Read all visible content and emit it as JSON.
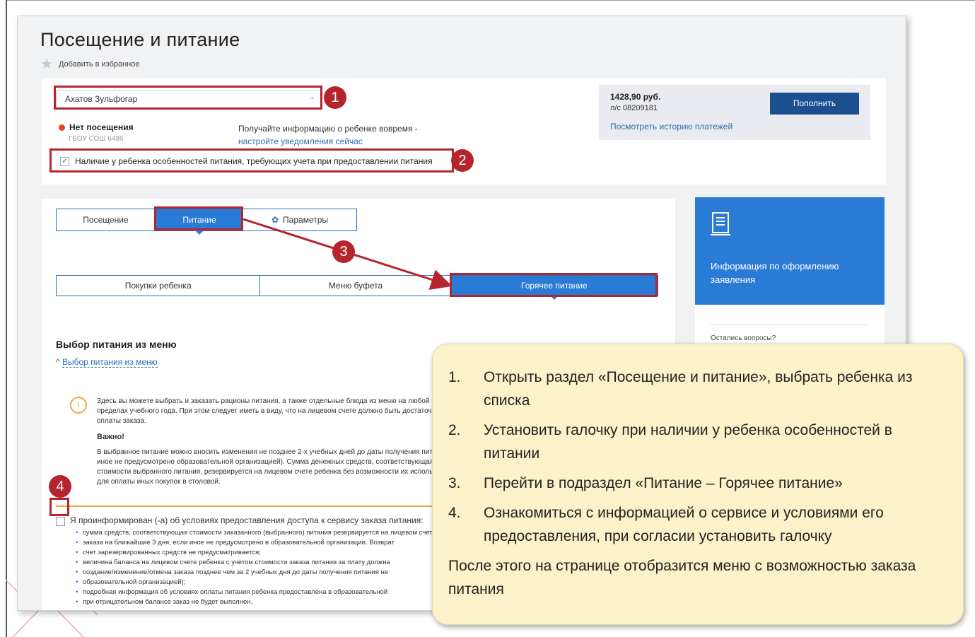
{
  "page": {
    "title": "Посещение и питание",
    "favorite": "Добавить в избранное"
  },
  "child": {
    "selected": "Ахатов Зульфогар",
    "status": "Нет посещения",
    "school": "ГБОУ СОШ 6486",
    "notify_text": "Получайте информацию о ребенке вовремя -",
    "notify_link": "настройте уведомления сейчас",
    "feature_label": "Наличие у ребенка особенностей питания, требующих учета при предоставлении питания"
  },
  "balance": {
    "amount": "1428,90 руб.",
    "account": "л/с 08209181",
    "history_link": "Посмотреть историю платежей",
    "topup_button": "Пополнить"
  },
  "tabs": [
    {
      "label": "Посещение",
      "active": false
    },
    {
      "label": "Питание",
      "active": true
    },
    {
      "label": "Параметры",
      "active": false
    }
  ],
  "subtabs": [
    {
      "label": "Покупки ребенка",
      "active": false
    },
    {
      "label": "Меню буфета",
      "active": false
    },
    {
      "label": "Горячее питание",
      "active": true
    }
  ],
  "section": {
    "title": "Выбор питания из меню",
    "toggle": "Выбор питания из меню",
    "info_text": "Здесь вы можете выбрать и заказать рационы питания, а также отдельные блюда из меню на любой период в пределах учебного года. При этом следует иметь в виду, что на лицевом счете должно быть достаточно для оплаты заказа.",
    "important": "Важно!",
    "info_text2": "В выбранное питание можно вносить изменения не позднее 2-х учебных дней до даты получения питания (если иное не предусмотрено образовательной организацией). Сумма денежных средств, соответствующая стоимости выбранного питания, резервируется на лицевом счете ребенка без возможности их использования для оплаты иных покупок в столовой."
  },
  "agreement": {
    "label": "Я проинформирован (-а) об условиях предоставления доступа к сервису заказа питания:",
    "items": [
      "сумма средств, соответствующая стоимости заказанного (выбранного) питания резервируется на лицевом счете ребенка",
      "заказа на ближайшие 3 дня, если иное не предусмотрено в образовательной организации. Возврат",
      "счет зарезервированных средств не предусматривается;",
      "величина баланса на лицевом счете ребенка с учетом стоимости заказа питания за плату должна",
      "создание/изменение/отмена заказа позднее чем за 2 учебных дня до даты получения питания не",
      "образовательной организацией);",
      "подробная информация об условиях оплаты питания ребенка предоставлена в образовательной",
      "при отрицательном балансе заказ не будет выполнен."
    ]
  },
  "sidebar": {
    "info_text": "Информация по оформлению заявления",
    "questions": "Остались вопросы?"
  },
  "badges": [
    "1",
    "2",
    "3",
    "4"
  ],
  "instructions": {
    "steps": [
      {
        "num": "1.",
        "text": "Открыть раздел «Посещение и питание», выбрать ребенка из списка"
      },
      {
        "num": "2.",
        "text": "Установить галочку при наличии у ребенка особенностей в питании"
      },
      {
        "num": "3.",
        "text": "Перейти в подраздел «Питание – Горячее питание»"
      },
      {
        "num": "4.",
        "text": "Ознакомиться с информацией о сервисе и условиями его предоставления, при согласии установить галочку"
      }
    ],
    "after": "После этого на странице отобразится меню с возможностью заказа питания"
  },
  "colors": {
    "accent_blue": "#2a7bd5",
    "button_navy": "#1c4f8f",
    "highlight_red": "#b5252d",
    "note_bg": "#fcf2c9"
  }
}
